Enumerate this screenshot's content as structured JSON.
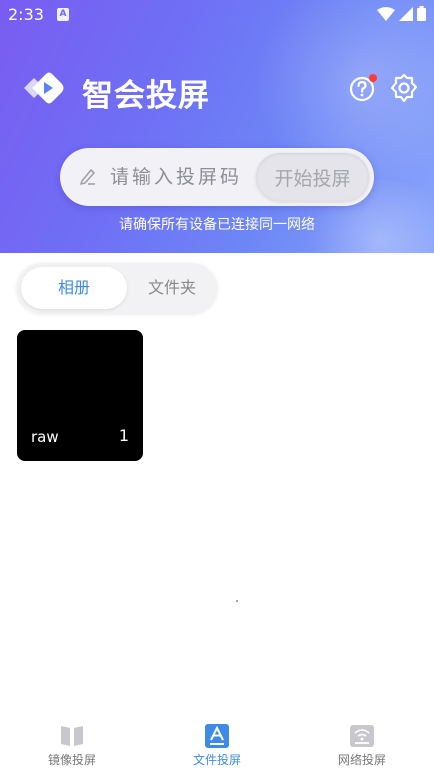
{
  "status_bar": {
    "time": "2:33",
    "notification_badge": "A"
  },
  "header": {
    "app_name": "智会投屏",
    "code_placeholder": "请输入投屏码",
    "start_button": "开始投屏",
    "hint": "请确保所有设备已连接同一网络"
  },
  "tabs": [
    {
      "label": "相册",
      "active": true
    },
    {
      "label": "文件夹",
      "active": false
    }
  ],
  "albums": [
    {
      "name": "raw",
      "count": "1"
    }
  ],
  "bottom_nav": [
    {
      "label": "镜像投屏",
      "icon": "mirror-cast-icon",
      "active": false
    },
    {
      "label": "文件投屏",
      "icon": "file-cast-icon",
      "active": true
    },
    {
      "label": "网络投屏",
      "icon": "network-cast-icon",
      "active": false
    }
  ],
  "colors": {
    "accent": "#3e8be6",
    "header_start": "#7a5cf2",
    "header_end": "#8aa6fb",
    "badge": "#ff3b3b"
  }
}
